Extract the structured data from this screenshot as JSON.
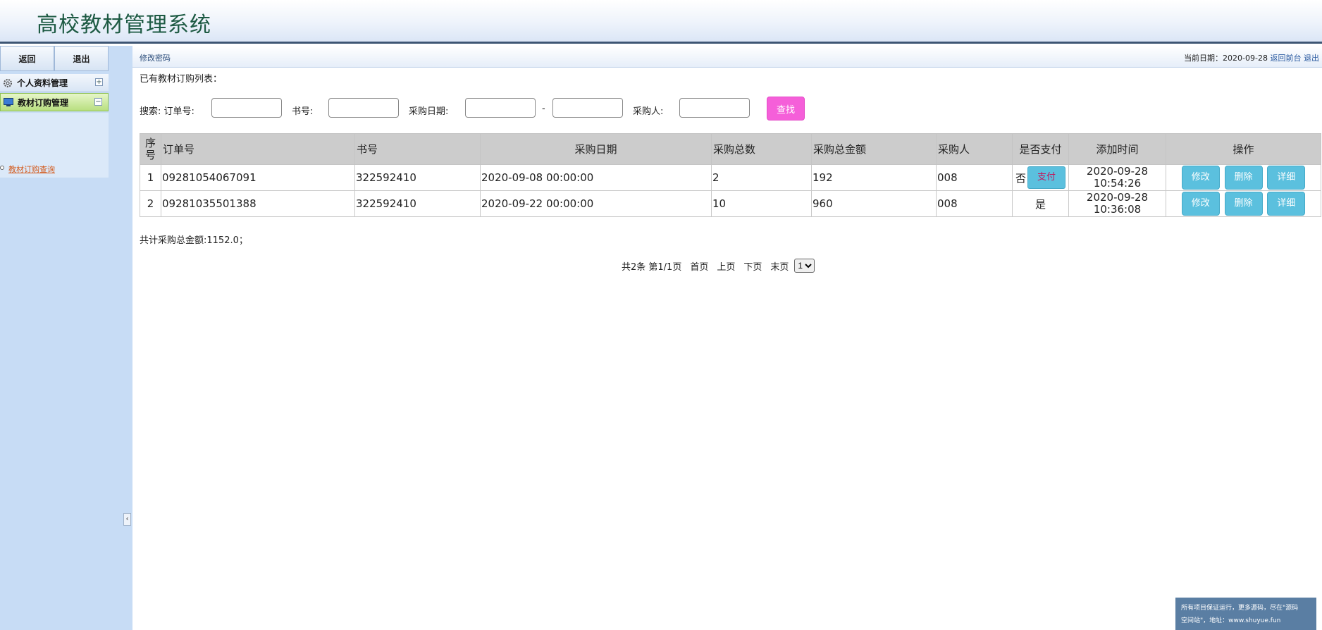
{
  "app": {
    "title": "高校教材管理系统"
  },
  "sidebar": {
    "back_label": "返回",
    "logout_label": "退出",
    "menus": [
      {
        "label": "个人资料管理",
        "expand": "+"
      },
      {
        "label": "教材订购管理",
        "expand": "−"
      }
    ],
    "submenu_link": "教材订购查询",
    "collapse_glyph": "‹"
  },
  "topbar": {
    "change_password": "修改密码",
    "date_label": "当前日期：2020-09-28",
    "back_front": "返回前台",
    "logout": "退出"
  },
  "list_title": "已有教材订购列表：",
  "search": {
    "prefix": "搜索: 订单号:",
    "book_label": "书号:",
    "date_label": "采购日期:",
    "dash": "-",
    "buyer_label": "采购人:",
    "button": "查找"
  },
  "table": {
    "headers": [
      "序号",
      "订单号",
      "书号",
      "采购日期",
      "采购总数",
      "采购总金额",
      "采购人",
      "是否支付",
      "添加时间",
      "操作"
    ],
    "rows": [
      {
        "no": "1",
        "order_no": "09281054067091",
        "book_no": "322592410",
        "date": "2020-09-08 00:00:00",
        "qty": "2",
        "amount": "192",
        "buyer": "008",
        "paid": "否",
        "pay_btn": "支付",
        "add_date": "2020-09-28",
        "add_time": "10:54:26"
      },
      {
        "no": "2",
        "order_no": "09281035501388",
        "book_no": "322592410",
        "date": "2020-09-22 00:00:00",
        "qty": "10",
        "amount": "960",
        "buyer": "008",
        "paid": "是",
        "pay_btn": "",
        "add_date": "2020-09-28",
        "add_time": "10:36:08"
      }
    ],
    "ops": {
      "edit": "修改",
      "delete": "删除",
      "detail": "详细"
    }
  },
  "total_line": "共计采购总金额:1152.0；",
  "pager": {
    "summary": "共2条 第1/1页",
    "first": "首页",
    "prev": "上页",
    "next": "下页",
    "last": "末页",
    "page_option": "1"
  },
  "watermark": {
    "line1": "所有项目保证运行，更多源码，尽在\"源码",
    "line2": "空间站\"，地址：www.shuyue.fun"
  },
  "colors": {
    "search_button": "#f55fd9",
    "op_button": "#5bc0de",
    "header_border": "#3d5573",
    "sidebar_bg": "#c7dcf5"
  }
}
